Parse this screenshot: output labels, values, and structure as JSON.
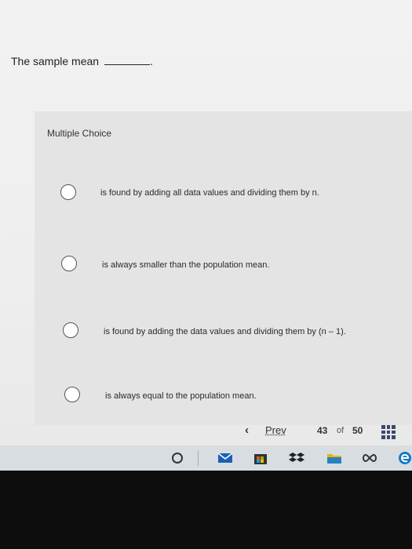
{
  "question": {
    "text": "The sample mean",
    "end_punct": "."
  },
  "multiple_choice": {
    "label": "Multiple Choice",
    "options": [
      {
        "text": "is found by adding all data values and dividing them by n."
      },
      {
        "text": "is always smaller than the population mean."
      },
      {
        "text": "is found by adding the data values and dividing them by (n – 1)."
      },
      {
        "text": "is always equal to the population mean."
      }
    ]
  },
  "navigation": {
    "prev_icon": "‹",
    "prev_label": "Prev",
    "current_page": "43",
    "of_label": "of",
    "total_pages": "50"
  },
  "taskbar": {
    "icons": [
      "cortana-circle-icon",
      "mail-icon",
      "store-icon",
      "dropbox-icon",
      "file-explorer-icon",
      "infinity-icon",
      "edge-icon"
    ]
  },
  "colors": {
    "background": "#eeeeee",
    "panel": "#e4e4e4",
    "taskbar": "#d8dde2",
    "bezel": "#0d0d0d",
    "accent": "#3a4a6a"
  }
}
